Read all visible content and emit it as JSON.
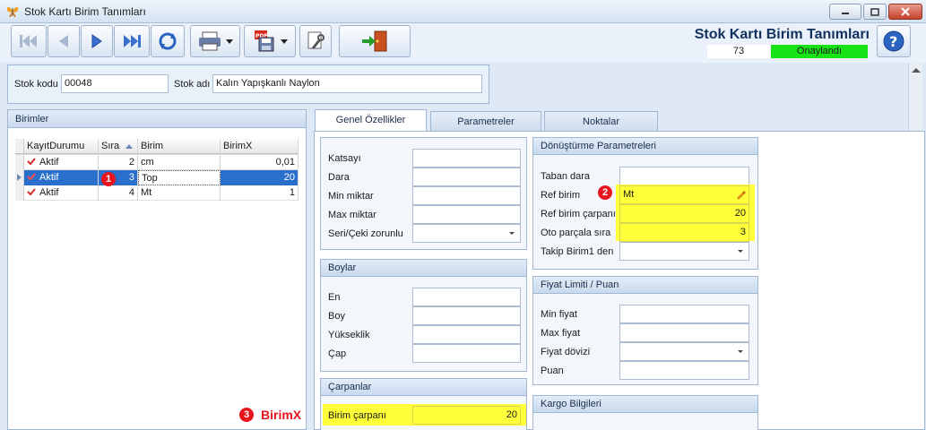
{
  "window": {
    "title": "Stok Kartı Birim Tanımları"
  },
  "header": {
    "title": "Stok Kartı Birim Tanımları",
    "count": "73",
    "status": "Onaylandı",
    "status_color": "#17e317"
  },
  "stock": {
    "code_label": "Stok kodu",
    "code_value": "00048",
    "name_label": "Stok adı",
    "name_value": "Kalın Yapışkanlı Naylon"
  },
  "birimler": {
    "title": "Birimler",
    "columns": [
      "KayıtDurumu",
      "Sıra",
      "Birim",
      "BirimX"
    ],
    "rows": [
      {
        "durum": "Aktif",
        "sira": "2",
        "birim": "cm",
        "birimx": "0,01"
      },
      {
        "durum": "Aktif",
        "sira": "3",
        "birim": "Top",
        "birimx": "20"
      },
      {
        "durum": "Aktif",
        "sira": "4",
        "birim": "Mt",
        "birimx": "1"
      }
    ]
  },
  "tabs": [
    {
      "label": "Genel Özellikler"
    },
    {
      "label": "Parametreler"
    },
    {
      "label": "Noktalar"
    }
  ],
  "genel": {
    "katsayi": "Katsayı",
    "dara": "Dara",
    "min_miktar": "Min miktar",
    "max_miktar": "Max miktar",
    "seri_ceki": "Seri/Çeki zorunlu"
  },
  "boylar": {
    "title": "Boylar",
    "en": "En",
    "boy": "Boy",
    "yukseklik": "Yükseklik",
    "cap": "Çap"
  },
  "carpanlar": {
    "title": "Çarpanlar",
    "birim_carpani_label": "Birim çarpanı",
    "birim_carpani_value": "20"
  },
  "donusturme": {
    "title": "Dönüştürme Parametreleri",
    "taban_dara": "Taban dara",
    "ref_birim_label": "Ref birim",
    "ref_birim_value": "Mt",
    "ref_birim_carpani_label": "Ref birim çarpanı",
    "ref_birim_carpani_value": "20",
    "oto_parca_sira_label": "Oto parçala sıra",
    "oto_parca_sira_value": "3",
    "takip_birim_label": "Takip Birim1 den"
  },
  "fiyat": {
    "title": "Fiyat Limiti / Puan",
    "min_fiyat": "Min fiyat",
    "max_fiyat": "Max fiyat",
    "fiyat_dovizi": "Fiyat dövizi",
    "puan": "Puan"
  },
  "kargo": {
    "title": "Kargo Bilgileri"
  },
  "annotations": {
    "badge1": "1",
    "badge2": "2",
    "badge3": "3",
    "birimx_note": "BirimX",
    "accent": "#e8141e",
    "highlight": "#ffff3a"
  }
}
